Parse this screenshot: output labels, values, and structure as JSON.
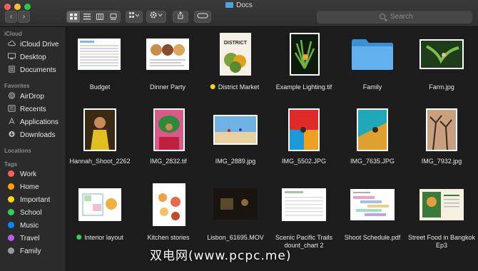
{
  "window": {
    "title": "Docs"
  },
  "toolbar": {
    "back_icon": "chevron-left-icon",
    "forward_icon": "chevron-right-icon",
    "search_placeholder": "Search"
  },
  "sidebar": {
    "sections": {
      "icloud": "iCloud",
      "favorites": "Favorites",
      "locations": "Locations",
      "tags": "Tags"
    },
    "icloud_items": [
      {
        "label": "iCloud Drive",
        "icon": "cloud-icon"
      },
      {
        "label": "Desktop",
        "icon": "desktop-icon"
      },
      {
        "label": "Documents",
        "icon": "document-icon"
      }
    ],
    "favorite_items": [
      {
        "label": "AirDrop",
        "icon": "airdrop-icon"
      },
      {
        "label": "Recents",
        "icon": "clock-icon"
      },
      {
        "label": "Applications",
        "icon": "applications-icon"
      },
      {
        "label": "Downloads",
        "icon": "download-icon"
      }
    ],
    "tags": [
      {
        "label": "Work",
        "color": "#ff5f57"
      },
      {
        "label": "Home",
        "color": "#ff9f0a"
      },
      {
        "label": "Important",
        "color": "#ffd60a"
      },
      {
        "label": "School",
        "color": "#30d158"
      },
      {
        "label": "Music",
        "color": "#0a84ff"
      },
      {
        "label": "Travel",
        "color": "#bf5af2"
      },
      {
        "label": "Family",
        "color": "#9a9a9a"
      }
    ]
  },
  "files": [
    {
      "name": "Budget"
    },
    {
      "name": "Dinner Party"
    },
    {
      "name": "District Market",
      "tag_color": "#ffd60a"
    },
    {
      "name": "Example Lighting.tif"
    },
    {
      "name": "Family"
    },
    {
      "name": "Farm.jpg"
    },
    {
      "name": "Hannah_Shoot_2262"
    },
    {
      "name": "IMG_2832.tif"
    },
    {
      "name": "IMG_2889.jpg"
    },
    {
      "name": "IMG_5502.JPG"
    },
    {
      "name": "IMG_7635.JPG"
    },
    {
      "name": "IMG_7932.jpg"
    },
    {
      "name": "Interior layout",
      "tag_color": "#30d158"
    },
    {
      "name": "Kitchen stories"
    },
    {
      "name": "Lisbon_61695.MOV"
    },
    {
      "name": "Scenic Pacific Trails dount_chart 2"
    },
    {
      "name": "Shoot Schedule.pdf"
    },
    {
      "name": "Street Food in Bangkok Ep3"
    }
  ],
  "watermark": "双电网(www.pcpc.me)"
}
